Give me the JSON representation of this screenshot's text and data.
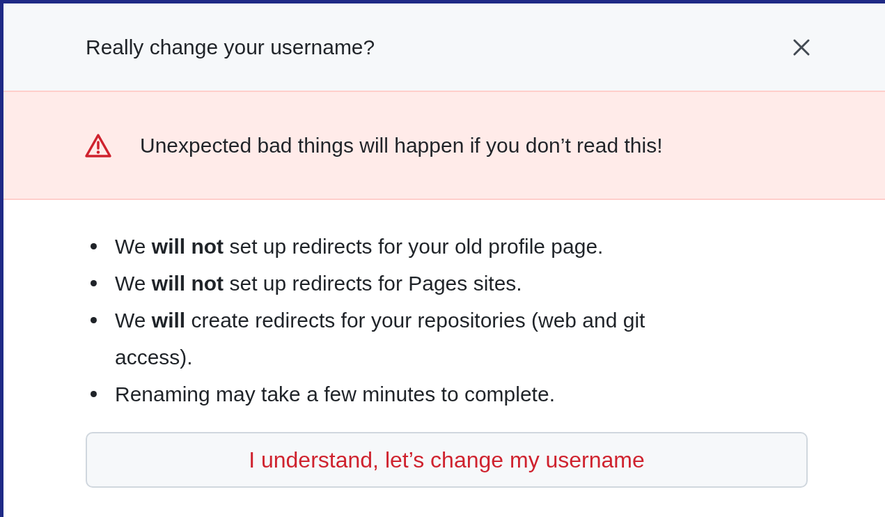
{
  "dialog": {
    "title": "Really change your username?",
    "alert": {
      "text": "Unexpected bad things will happen if you don’t read this!"
    },
    "items": [
      "We **will not** set up redirects for your old profile page.",
      "We **will not** set up redirects for Pages sites.",
      "We **will** create redirects for your repositories (web and git access).",
      "Renaming may take a few minutes to complete."
    ],
    "confirm_button": "I understand, let’s change my username"
  }
}
